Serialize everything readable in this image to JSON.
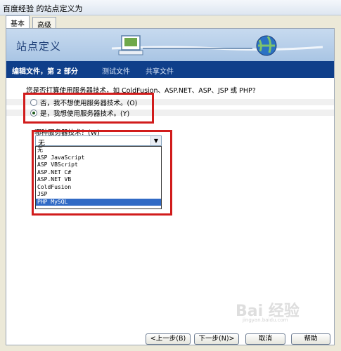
{
  "window": {
    "title": "百度经验 的站点定义为"
  },
  "tabs": [
    {
      "label": "基本",
      "active": true
    },
    {
      "label": "高级",
      "active": false
    }
  ],
  "banner": {
    "title": "站点定义"
  },
  "steps": {
    "current": "编辑文件，第 2 部分",
    "test": "测试文件",
    "share": "共享文件"
  },
  "question": "您是否打算使用服务器技术，如 ColdFusion、ASP.NET、ASP、JSP 或 PHP?",
  "radios": [
    {
      "label": "否，我不想使用服务器技术。(O)",
      "checked": false
    },
    {
      "label": "是，我想使用服务器技术。(Y)",
      "checked": true
    }
  ],
  "server_tech": {
    "label": "哪种服务器技术？(W)",
    "selected": "无",
    "options": [
      "无",
      "ASP JavaScript",
      "ASP VBScript",
      "ASP.NET C#",
      "ASP.NET VB",
      "ColdFusion",
      "JSP",
      "PHP MySQL"
    ],
    "highlighted": "PHP MySQL"
  },
  "buttons": {
    "back": "<上一步(B)",
    "next": "下一步(N)>",
    "cancel": "取消",
    "help": "帮助"
  },
  "watermark": {
    "main": "Bai 经验",
    "sub": "jingyan.baidu.com"
  },
  "colors": {
    "step_bar": "#0f3f8a",
    "highlight": "#d11c1c",
    "selection": "#316ac5"
  }
}
